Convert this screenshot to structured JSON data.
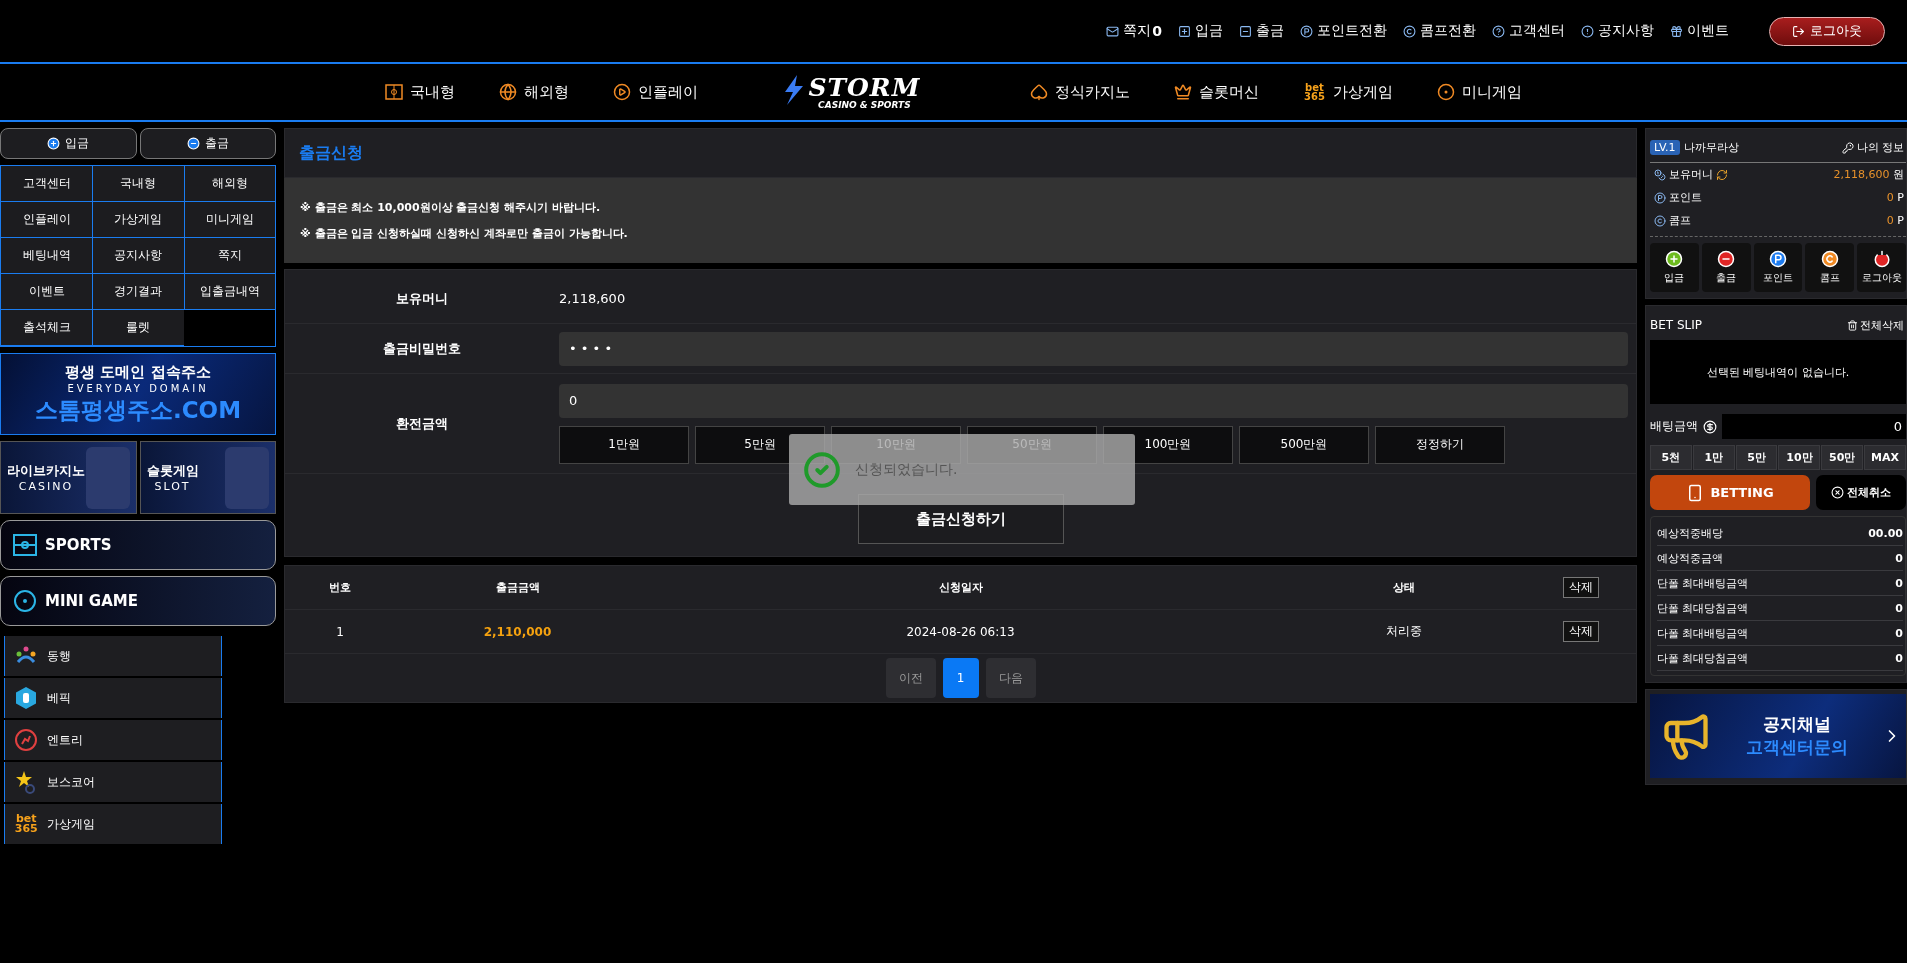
{
  "top_links": [
    {
      "label": "쪽지",
      "badge": "0"
    },
    {
      "label": "입금"
    },
    {
      "label": "출금"
    },
    {
      "label": "포인트전환"
    },
    {
      "label": "콤프전환"
    },
    {
      "label": "고객센터"
    },
    {
      "label": "공지사항"
    },
    {
      "label": "이벤트"
    }
  ],
  "logout_button": "로그아웃",
  "nav_left": [
    {
      "label": "국내형"
    },
    {
      "label": "해외형"
    },
    {
      "label": "인플레이"
    }
  ],
  "logo": {
    "title": "STORM",
    "subtitle": "CASINO & SPORTS"
  },
  "nav_right": [
    {
      "label": "정식카지노"
    },
    {
      "label": "슬롯머신"
    },
    {
      "label": "가상게임",
      "logo": "bet365"
    },
    {
      "label": "미니게임"
    }
  ],
  "sidebar": {
    "cash_buttons": [
      "입금",
      "출금"
    ],
    "menu": [
      "고객센터",
      "국내형",
      "해외형",
      "인플레이",
      "가상게임",
      "미니게임",
      "베팅내역",
      "공지사항",
      "쪽지",
      "이벤트",
      "경기결과",
      "입출금내역",
      "출석체크",
      "룰렛"
    ],
    "domain_banner": {
      "line1": "평생 도메인 접속주소",
      "line2": "EVERYDAY DOMAIN",
      "line3": "스톰평생주소.COM"
    },
    "promo_banners": [
      {
        "title": "라이브카지노",
        "subtitle": "CASINO"
      },
      {
        "title": "슬롯게임",
        "subtitle": "SLOT"
      }
    ],
    "category_buttons": [
      "SPORTS",
      "MINI GAME"
    ],
    "providers": [
      {
        "label": "동행"
      },
      {
        "label": "베픽"
      },
      {
        "label": "엔트리"
      },
      {
        "label": "보스코어"
      },
      {
        "label": "가상게임",
        "logo": "bet365"
      }
    ]
  },
  "main": {
    "title": "출금신청",
    "notices": [
      "※ 출금은 최소 10,000원이상 출금신청 해주시기 바랍니다.",
      "※ 출금은 입금 신청하실때 신청하신 계좌로만 출금이 가능합니다."
    ],
    "form": {
      "money": {
        "label": "보유머니",
        "value": "2,118,600"
      },
      "password": {
        "label": "출금비밀번호",
        "value": "• • • •"
      },
      "amount": {
        "label": "환전금액",
        "value": "0",
        "quick_buttons": [
          "1만원",
          "5만원",
          "10만원",
          "50만원",
          "100만원",
          "500만원",
          "정정하기"
        ]
      },
      "submit": "출금신청하기"
    },
    "toast": {
      "message": "신청되었습니다."
    },
    "history": {
      "columns": [
        "번호",
        "출금금액",
        "신청일자",
        "상태"
      ],
      "delete_all": "삭제",
      "rows": [
        {
          "no": "1",
          "amount": "2,110,000",
          "date": "2024-08-26 06:13",
          "status": "처리중",
          "action": "삭제"
        }
      ]
    },
    "pagination": {
      "prev": "이전",
      "pages": [
        {
          "label": "1",
          "selected": true
        }
      ],
      "next": "다음"
    }
  },
  "right": {
    "user": {
      "level": "LV.1",
      "name": "나까무라상",
      "my_info": "나의 정보"
    },
    "balances": [
      {
        "label": "보유머니",
        "value": "2,118,600",
        "unit": "원"
      },
      {
        "label": "포인트",
        "value": "0",
        "unit": "P"
      },
      {
        "label": "콤프",
        "value": "0",
        "unit": "P"
      }
    ],
    "actions": [
      "입금",
      "출금",
      "포인트",
      "콤프",
      "로그아웃"
    ],
    "betslip": {
      "title": "BET SLIP",
      "clear": "전체삭제",
      "empty": "선택된 베팅내역이 없습니다.",
      "amount_label": "배팅금액",
      "amount_value": "0",
      "chips": [
        "5천",
        "1만",
        "5만",
        "10만",
        "50만",
        "MAX"
      ],
      "bet_button": "BETTING",
      "cancel": "전체취소",
      "summary": [
        {
          "label": "예상적중배당",
          "value": "00.00"
        },
        {
          "label": "예상적중금액",
          "value": "0"
        },
        {
          "label": "단폴 최대배팅금액",
          "value": "0"
        },
        {
          "label": "단폴 최대당첨금액",
          "value": "0"
        },
        {
          "label": "다폴 최대배팅금액",
          "value": "0"
        },
        {
          "label": "다폴 최대당첨금액",
          "value": "0"
        }
      ]
    },
    "notice_banner": {
      "line1": "공지채널",
      "line2": "고객센터문의"
    }
  }
}
